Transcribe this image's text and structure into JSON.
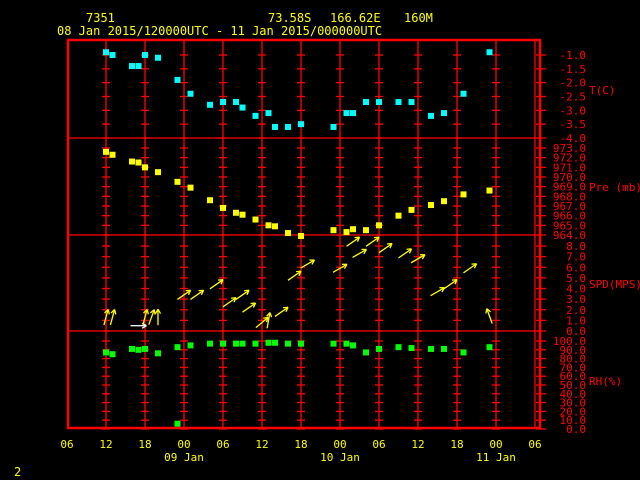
{
  "header": {
    "station": "7351",
    "lat": "73.58S",
    "lon": "166.62E",
    "elev": "160M",
    "range": "08 Jan 2015/120000UTC - 11 Jan 2015/000000UTC"
  },
  "page_number": "2",
  "colors": {
    "frame": "#ff0000",
    "text": "#ffff00",
    "temp": "#00ffff",
    "pressure": "#ffff00",
    "wind": "#ffff00",
    "wind_highlight": "#ffffff",
    "rh": "#00ff00"
  },
  "chart_data": {
    "type": "scatter",
    "x_axis": {
      "range": [
        "08 Jan 06",
        "11 Jan 06"
      ],
      "tick_labels": [
        "06",
        "12",
        "18",
        "00",
        "06",
        "12",
        "18",
        "00",
        "06",
        "12",
        "18",
        "00",
        "06"
      ],
      "date_labels": [
        {
          "at": "09 Jan 00",
          "label": "09 Jan"
        },
        {
          "at": "10 Jan 00",
          "label": "10 Jan"
        },
        {
          "at": "11 Jan 00",
          "label": "11 Jan"
        }
      ]
    },
    "grid": true,
    "panels": [
      {
        "name": "T(C)",
        "ylim": [
          -4.0,
          -1.0
        ],
        "ticks": [
          "-1.0",
          "-1.5",
          "-2.0",
          "-2.5",
          "-3.0",
          "-3.5",
          "-4.0"
        ],
        "series": {
          "x": [
            "08 Jan 12",
            "08 Jan 13",
            "08 Jan 16",
            "08 Jan 17",
            "08 Jan 18",
            "08 Jan 20",
            "08 Jan 23",
            "09 Jan 01",
            "09 Jan 04",
            "09 Jan 06",
            "09 Jan 08",
            "09 Jan 09",
            "09 Jan 11",
            "09 Jan 13",
            "09 Jan 14",
            "09 Jan 16",
            "09 Jan 18",
            "09 Jan 23",
            "10 Jan 01",
            "10 Jan 02",
            "10 Jan 04",
            "10 Jan 06",
            "10 Jan 09",
            "10 Jan 11",
            "10 Jan 14",
            "10 Jan 16",
            "10 Jan 19",
            "10 Jan 23"
          ],
          "y": [
            -0.9,
            -1.0,
            -1.4,
            -1.4,
            -1.0,
            -1.1,
            -1.9,
            -2.4,
            -2.8,
            -2.7,
            -2.7,
            -2.9,
            -3.2,
            -3.1,
            -3.6,
            -3.6,
            -3.5,
            -3.6,
            -3.1,
            -3.1,
            -2.7,
            -2.7,
            -2.7,
            -2.7,
            -3.2,
            -3.1,
            -2.4,
            -0.9
          ]
        }
      },
      {
        "name": "Pre (mb)",
        "ylim": [
          964.0,
          973.0
        ],
        "ticks": [
          "973.0",
          "972.0",
          "971.0",
          "970.0",
          "969.0",
          "968.0",
          "967.0",
          "966.0",
          "965.0",
          "964.0"
        ],
        "series": {
          "x": [
            "08 Jan 12",
            "08 Jan 13",
            "08 Jan 16",
            "08 Jan 17",
            "08 Jan 18",
            "08 Jan 20",
            "08 Jan 23",
            "09 Jan 01",
            "09 Jan 04",
            "09 Jan 06",
            "09 Jan 08",
            "09 Jan 09",
            "09 Jan 11",
            "09 Jan 13",
            "09 Jan 14",
            "09 Jan 16",
            "09 Jan 18",
            "09 Jan 23",
            "10 Jan 01",
            "10 Jan 02",
            "10 Jan 04",
            "10 Jan 06",
            "10 Jan 09",
            "10 Jan 11",
            "10 Jan 14",
            "10 Jan 16",
            "10 Jan 19",
            "10 Jan 23"
          ],
          "y": [
            972.6,
            972.3,
            971.6,
            971.5,
            971.0,
            970.5,
            969.5,
            968.9,
            967.6,
            966.8,
            966.3,
            966.1,
            965.6,
            965.0,
            964.9,
            964.2,
            963.9,
            964.5,
            964.3,
            964.6,
            964.5,
            965.0,
            966.0,
            966.6,
            967.1,
            967.5,
            968.2,
            968.6
          ]
        }
      },
      {
        "name": "SPD(MPS)",
        "ylim": [
          0.0,
          8.0
        ],
        "ticks": [
          "8.0",
          "7.0",
          "6.0",
          "5.0",
          "4.0",
          "3.0",
          "2.0",
          "1.0",
          "0.0"
        ],
        "series": {
          "x": [
            "08 Jan 12",
            "08 Jan 13",
            "08 Jan 17",
            "08 Jan 18",
            "08 Jan 19",
            "08 Jan 20",
            "09 Jan 00",
            "09 Jan 02",
            "09 Jan 05",
            "09 Jan 07",
            "09 Jan 09",
            "09 Jan 10",
            "09 Jan 12",
            "09 Jan 13",
            "09 Jan 15",
            "09 Jan 17",
            "09 Jan 19",
            "10 Jan 00",
            "10 Jan 02",
            "10 Jan 03",
            "10 Jan 05",
            "10 Jan 07",
            "10 Jan 10",
            "10 Jan 12",
            "10 Jan 15",
            "10 Jan 17",
            "10 Jan 20",
            "10 Jan 23"
          ],
          "y": [
            1.3,
            1.3,
            0.5,
            1.3,
            1.3,
            1.3,
            3.4,
            3.4,
            4.4,
            2.7,
            3.4,
            2.2,
            0.8,
            1.0,
            1.8,
            5.2,
            6.3,
            5.9,
            8.4,
            7.3,
            8.4,
            7.8,
            7.3,
            6.8,
            3.7,
            4.4,
            5.9,
            1.4
          ],
          "direction_deg": [
            15,
            15,
            90,
            15,
            20,
            0,
            55,
            55,
            55,
            55,
            55,
            55,
            50,
            10,
            55,
            55,
            60,
            60,
            55,
            60,
            55,
            55,
            55,
            60,
            60,
            55,
            55,
            340
          ],
          "highlight_x": "08 Jan 17"
        }
      },
      {
        "name": "RH(%)",
        "ylim": [
          0.0,
          100.0
        ],
        "ticks": [
          "100.0",
          "90.0",
          "80.0",
          "70.0",
          "60.0",
          "50.0",
          "40.0",
          "30.0",
          "20.0",
          "10.0",
          "0.0"
        ],
        "series": {
          "x": [
            "08 Jan 12",
            "08 Jan 13",
            "08 Jan 16",
            "08 Jan 17",
            "08 Jan 18",
            "08 Jan 20",
            "08 Jan 23",
            "08 Jan 23",
            "09 Jan 01",
            "09 Jan 04",
            "09 Jan 06",
            "09 Jan 08",
            "09 Jan 09",
            "09 Jan 11",
            "09 Jan 13",
            "09 Jan 14",
            "09 Jan 16",
            "09 Jan 18",
            "09 Jan 23",
            "10 Jan 01",
            "10 Jan 02",
            "10 Jan 04",
            "10 Jan 06",
            "10 Jan 09",
            "10 Jan 11",
            "10 Jan 14",
            "10 Jan 16",
            "10 Jan 19",
            "10 Jan 23"
          ],
          "y": [
            87,
            85,
            91,
            90,
            91,
            86,
            93,
            6,
            95,
            97,
            97,
            97,
            97,
            97,
            98,
            98,
            97,
            97,
            97,
            97,
            95,
            87,
            91,
            93,
            92,
            91,
            91,
            87,
            93
          ]
        }
      }
    ]
  }
}
